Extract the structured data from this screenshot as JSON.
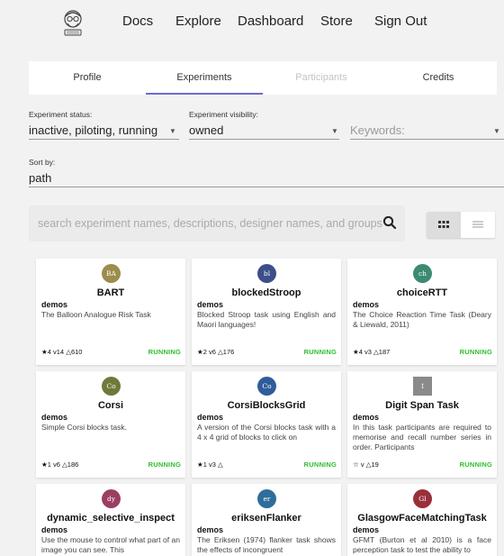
{
  "nav": {
    "links": [
      "Docs",
      "Explore",
      "Dashboard",
      "Store",
      "Sign Out"
    ]
  },
  "tabs": [
    {
      "label": "Profile",
      "state": "normal"
    },
    {
      "label": "Experiments",
      "state": "active"
    },
    {
      "label": "Participants",
      "state": "disabled"
    },
    {
      "label": "Credits",
      "state": "normal"
    }
  ],
  "filters": {
    "status_label": "Experiment status:",
    "status_value": "inactive, piloting, running",
    "visibility_label": "Experiment visibility:",
    "visibility_value": "owned",
    "keywords_placeholder": "Keywords:",
    "sort_label": "Sort by:",
    "sort_value": "path"
  },
  "search": {
    "placeholder": "search experiment names, descriptions, designer names, and groups"
  },
  "colors": {
    "accent": "#6b6bd8",
    "running": "#2dbf2d"
  },
  "cards": [
    {
      "title": "BART",
      "initials": "BA",
      "avatar_color": "#9c8c4d",
      "group": "demos",
      "description": "The Balloon Analogue Risk Task",
      "stars": "4",
      "version": "v14",
      "runs": "610",
      "status": "RUNNING"
    },
    {
      "title": "blockedStroop",
      "initials": "bl",
      "avatar_color": "#3c4f8a",
      "group": "demos",
      "description": "Blocked Stroop task using English and Maori languages!",
      "stars": "2",
      "version": "v6",
      "runs": "176",
      "status": "RUNNING"
    },
    {
      "title": "choiceRTT",
      "initials": "ch",
      "avatar_color": "#3c8a72",
      "group": "demos",
      "description": "The Choice Reaction Time Task (Deary & Liewald, 2011)",
      "stars": "4",
      "version": "v3",
      "runs": "187",
      "status": "RUNNING"
    },
    {
      "title": "Corsi",
      "initials": "Co",
      "avatar_color": "#6e7a3a",
      "group": "demos",
      "description": "Simple Corsi blocks task.",
      "stars": "1",
      "version": "v6",
      "runs": "186",
      "status": "RUNNING"
    },
    {
      "title": "CorsiBlocksGrid",
      "initials": "Co",
      "avatar_color": "#2f5d9a",
      "group": "demos",
      "description": "A version of the Corsi blocks task with a 4 x 4 grid of blocks to click on",
      "stars": "1",
      "version": "v3",
      "runs": "",
      "status": "RUNNING"
    },
    {
      "title": "Digit Span Task",
      "initials": "↕",
      "avatar_color": "#8a8a8a",
      "group": "demos",
      "description": "In this task participants are required to memorise and recall number series in order. Participants",
      "stars": "",
      "version": "v",
      "runs": "19",
      "status": "RUNNING"
    },
    {
      "title": "dynamic_selective_inspect",
      "initials": "dy",
      "avatar_color": "#9a3f62",
      "group": "demos",
      "description": "Use the mouse to control what part of an image you can see. This",
      "stars": "",
      "version": "",
      "runs": "",
      "status": ""
    },
    {
      "title": "eriksenFlanker",
      "initials": "er",
      "avatar_color": "#2f6e9a",
      "group": "demos",
      "description": "The Eriksen (1974) flanker task shows the effects of incongruent",
      "stars": "",
      "version": "",
      "runs": "",
      "status": ""
    },
    {
      "title": "GlasgowFaceMatchingTask",
      "initials": "Gl",
      "avatar_color": "#9a2f3a",
      "group": "demos",
      "description": "GFMT (Burton et al 2010) is a face perception task to test the ability to",
      "stars": "",
      "version": "",
      "runs": "",
      "status": ""
    }
  ]
}
